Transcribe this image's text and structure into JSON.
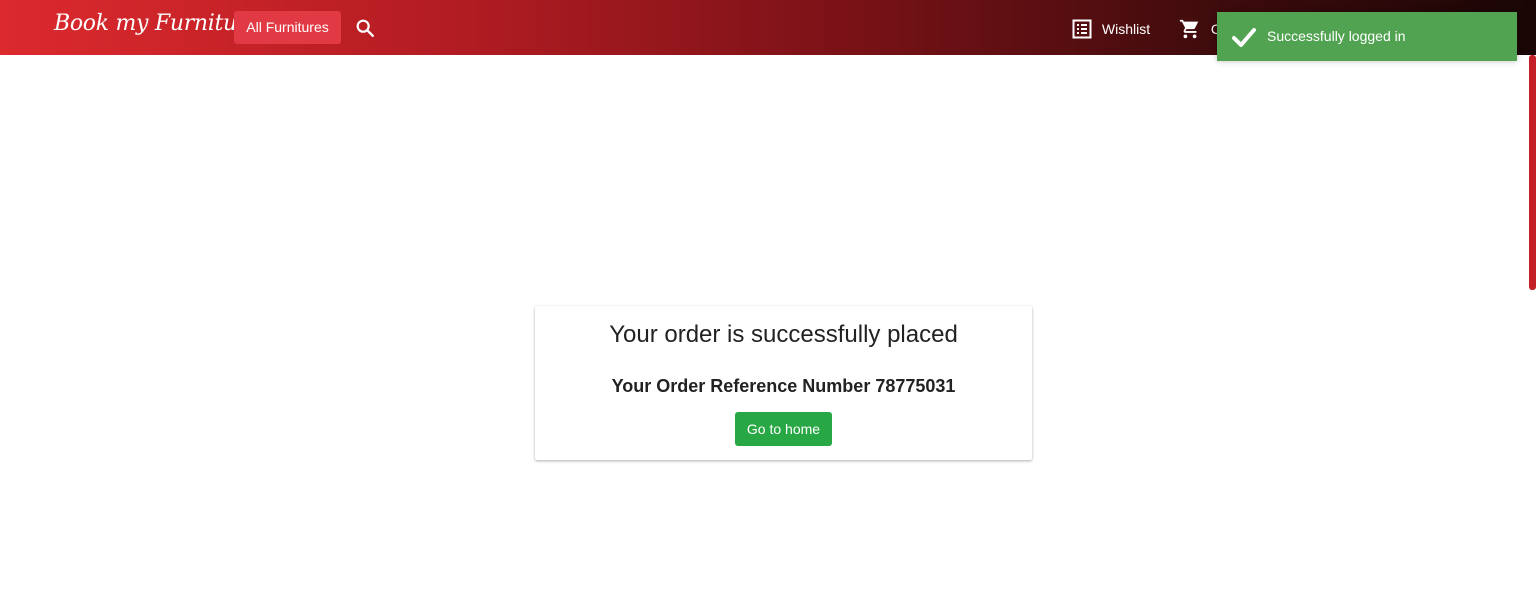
{
  "header": {
    "brand": "Book my Furniture",
    "all_furnitures_label": "All Furnitures",
    "wishlist_label": "Wishlist",
    "cart_label": "C"
  },
  "toast": {
    "message": "Successfully logged in"
  },
  "order": {
    "title": "Your order is successfully placed",
    "reference_label": "Your Order Reference Number",
    "reference_number": "78775031",
    "reference_text": "Your Order Reference Number 78775031",
    "home_button_label": "Go to home"
  },
  "icons": {
    "search": "search-icon",
    "wishlist": "list-icon",
    "cart": "cart-icon",
    "toast": "check-icon"
  },
  "colors": {
    "header_gradient_start": "#dc2a2e",
    "header_gradient_end": "#1a0606",
    "all_button": "#e23a45",
    "toast_bg": "#51a351",
    "home_button": "#28a745"
  }
}
